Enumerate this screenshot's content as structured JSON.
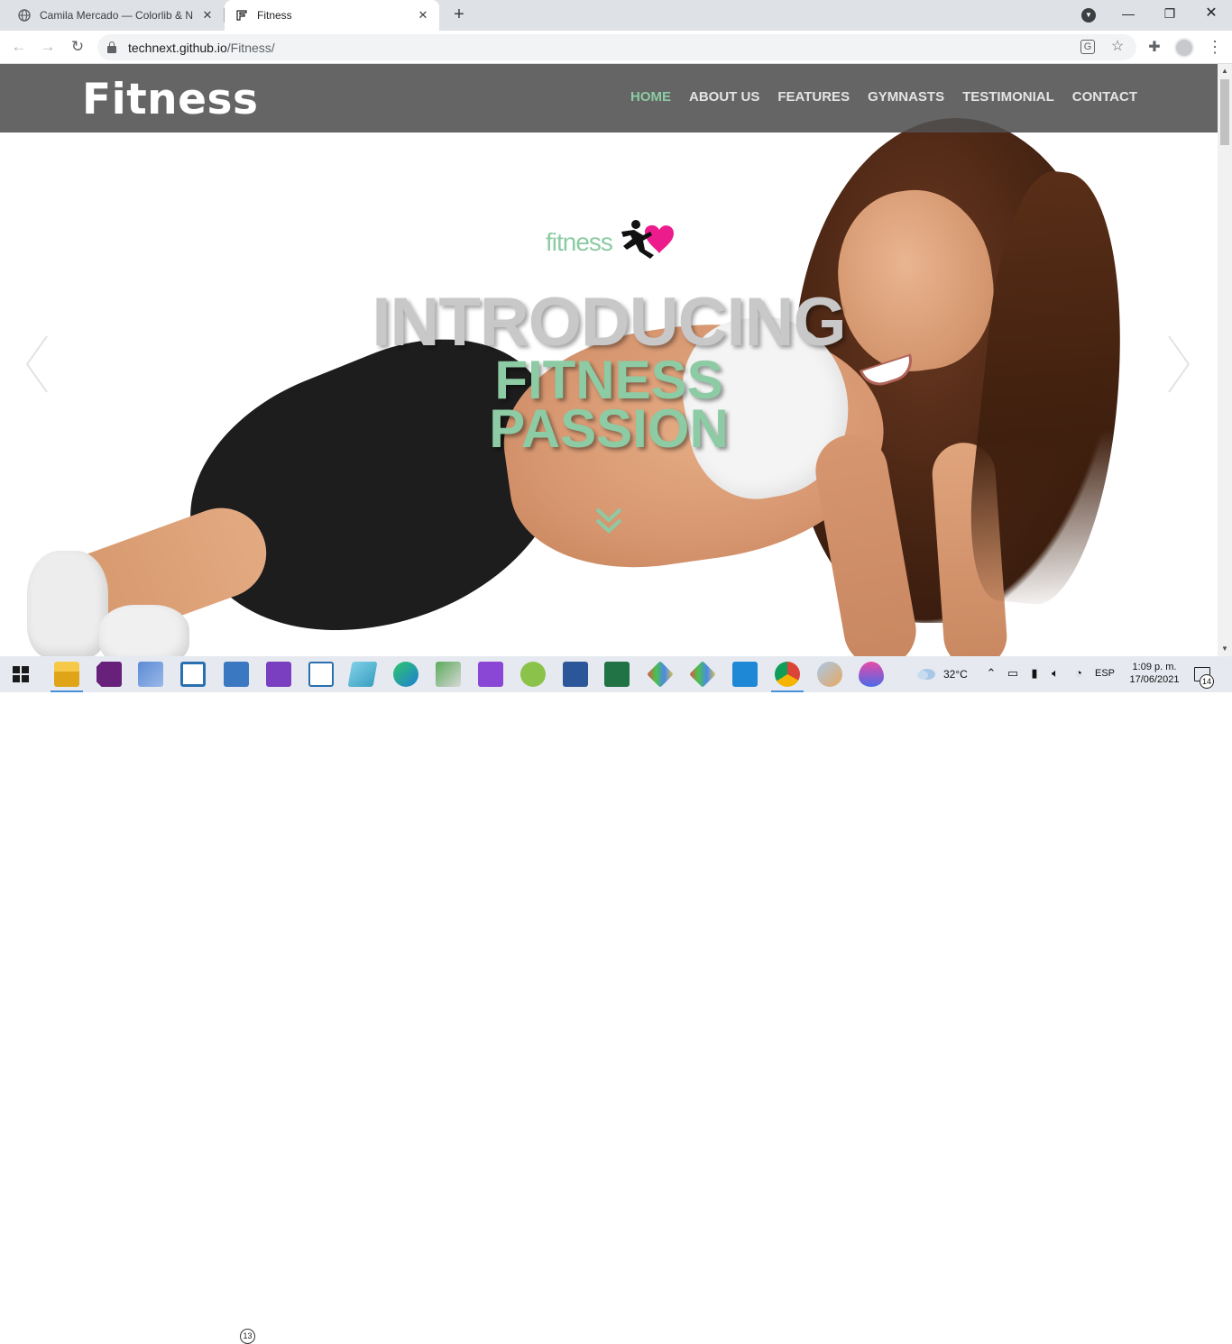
{
  "browser": {
    "tabs": [
      {
        "title": "Camila Mercado — Colorlib & Nc",
        "icon": "globe-icon",
        "active": false
      },
      {
        "title": "Fitness",
        "icon": "fitness-favicon",
        "active": true
      }
    ],
    "url_domain": "technext.github.io",
    "url_path": "/Fitness/"
  },
  "site": {
    "logo": "Fitness",
    "nav": [
      {
        "label": "HOME",
        "active": true
      },
      {
        "label": "ABOUT US",
        "active": false
      },
      {
        "label": "FEATURES",
        "active": false
      },
      {
        "label": "GYMNASTS",
        "active": false
      },
      {
        "label": "TESTIMONIAL",
        "active": false
      },
      {
        "label": "CONTACT",
        "active": false
      }
    ],
    "hero": {
      "brand_text": "fitness",
      "title": "INTRODUCING",
      "subtitle_line1": "FITNESS",
      "subtitle_line2": "PASSION"
    },
    "colors": {
      "accent": "#8ccba4",
      "header_bg": "#505050",
      "heart": "#ec1c8c"
    }
  },
  "taskbar": {
    "mail_badge": "13",
    "temperature": "32°C",
    "language": "ESP",
    "time": "1:09 p. m.",
    "date": "17/06/2021",
    "notification_count": "14"
  }
}
